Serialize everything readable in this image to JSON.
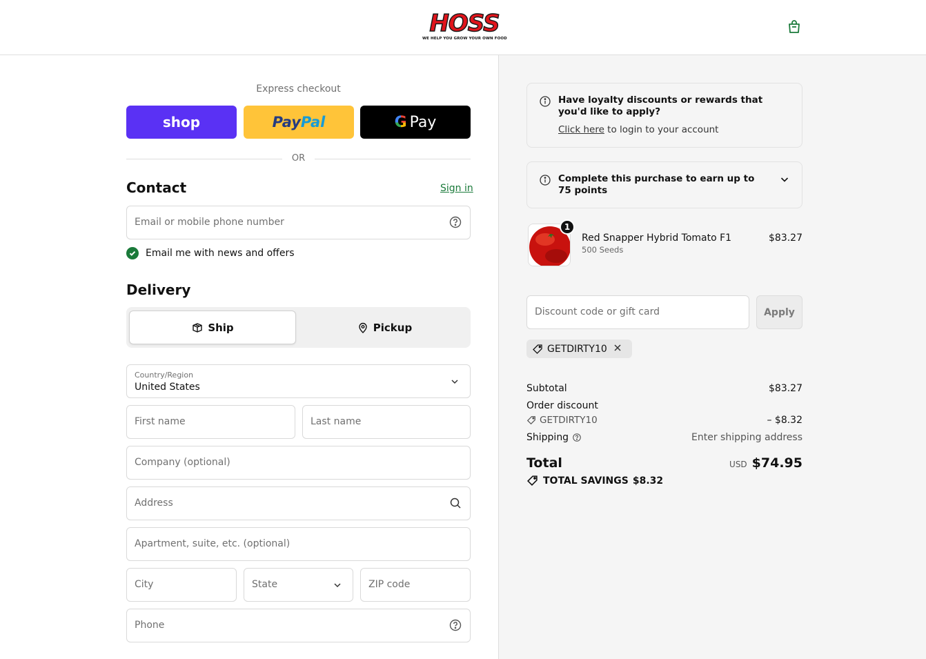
{
  "header": {
    "logo_text": "HOSS",
    "logo_tagline": "WE HELP YOU GROW YOUR OWN FOOD"
  },
  "express": {
    "label": "Express checkout",
    "shop": "shop",
    "paypal_1": "Pay",
    "paypal_2": "Pal",
    "gpay_g": "G",
    "gpay": "Pay",
    "or": "OR"
  },
  "contact": {
    "title": "Contact",
    "sign_in": "Sign in",
    "email_placeholder": "Email or mobile phone number",
    "news_label": "Email me with news and offers",
    "news_checked": true
  },
  "delivery": {
    "title": "Delivery",
    "ship": "Ship",
    "pickup": "Pickup",
    "country_label": "Country/Region",
    "country_value": "United States",
    "first_name": "First name",
    "last_name": "Last name",
    "company": "Company (optional)",
    "address": "Address",
    "apartment": "Apartment, suite, etc. (optional)",
    "city": "City",
    "state": "State",
    "zip": "ZIP code",
    "phone": "Phone"
  },
  "loyalty": {
    "question": "Have loyalty discounts or rewards that you'd like to apply?",
    "link": "Click here",
    "link_rest": " to login to your account"
  },
  "points": {
    "line1": "Complete this purchase to earn up to",
    "line2": "75 points"
  },
  "product": {
    "qty": "1",
    "name": "Red Snapper Hybrid Tomato F1",
    "variant": "500 Seeds",
    "price": "$83.27"
  },
  "discount": {
    "placeholder": "Discount code or gift card",
    "apply": "Apply",
    "code": "GETDIRTY10"
  },
  "summary": {
    "subtotal_label": "Subtotal",
    "subtotal_value": "$83.27",
    "order_discount_label": "Order discount",
    "discount_code": "GETDIRTY10",
    "discount_value": "– $8.32",
    "shipping_label": "Shipping",
    "shipping_value": "Enter shipping address",
    "total_label": "Total",
    "currency": "USD",
    "total_value": "$74.95",
    "savings_label": "TOTAL SAVINGS",
    "savings_value": "$8.32"
  },
  "colors": {
    "shop": "#5a31f4",
    "paypal": "#ffc439",
    "link_green": "#1a7a3a",
    "logo_red": "#e1141b"
  }
}
